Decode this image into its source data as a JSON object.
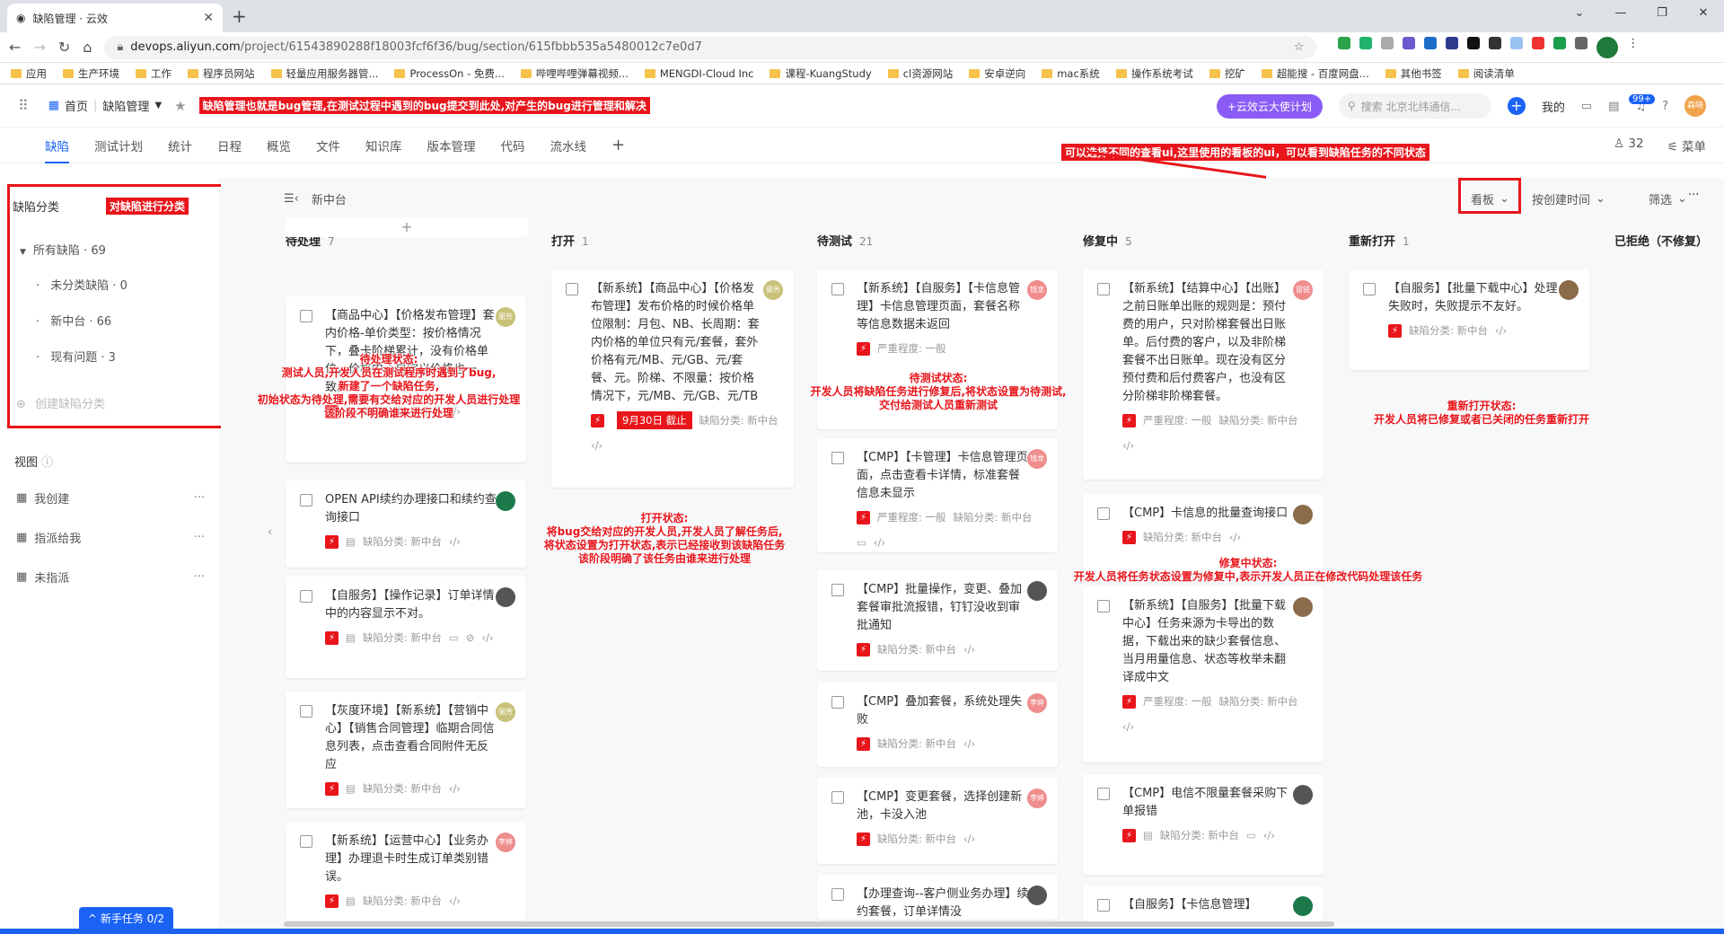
{
  "browser": {
    "tab_title": "缺陷管理 · 云效",
    "url_host": "devops.aliyun.com",
    "url_path": "/project/61543890288f18003fcf6f36/bug/section/615fbbb535a5480012c7e0d7",
    "bookmarks": [
      "应用",
      "生产环境",
      "工作",
      "程序员网站",
      "轻量应用服务器管...",
      "ProcessOn - 免费...",
      "哔哩哔哩弹幕视频...",
      "MENGDI-Cloud Inc",
      "课程-KuangStudy",
      "cl资源网站",
      "安卓逆向",
      "mac系统",
      "操作系统考试",
      "挖矿",
      "超能搜 - 百度网盘...",
      "其他书签",
      "阅读清单"
    ]
  },
  "header": {
    "home": "首页",
    "module": "缺陷管理",
    "annotation": "缺陷管理也就是bug管理,在测试过程中遇到的bug提交到此处,对产生的bug进行管理和解决",
    "promo": "+云效云大使计划",
    "search_placeholder": "搜索 北京北纬通信...",
    "mine": "我的",
    "badge": "99+",
    "user": "森晓"
  },
  "subnav": {
    "tabs": [
      "缺陷",
      "测试计划",
      "统计",
      "日程",
      "概览",
      "文件",
      "知识库",
      "版本管理",
      "代码",
      "流水线"
    ],
    "members": "32",
    "menu": "菜单",
    "annotation": "可以选择不同的查看ui,这里使用的看板的ui，可以看到缺陷任务的不同状态"
  },
  "sidebar": {
    "title": "缺陷分类",
    "annotation": "对缺陷进行分类",
    "all": "所有缺陷 · 69",
    "items": [
      "未分类缺陷 · 0",
      "新中台 · 66",
      "现有问题 · 3"
    ],
    "create": "创建缺陷分类",
    "views_title": "视图",
    "views": [
      "我创建",
      "指派给我",
      "未指派"
    ]
  },
  "board": {
    "crumb": "新中台",
    "view": "看板",
    "sort": "按创建时间",
    "filter": "筛选",
    "columns": [
      {
        "name": "待处理",
        "count": "7"
      },
      {
        "name": "打开",
        "count": "1"
      },
      {
        "name": "待测试",
        "count": "21"
      },
      {
        "name": "修复中",
        "count": "5"
      },
      {
        "name": "重新打开",
        "count": "1"
      },
      {
        "name": "已拒绝（不修复）",
        "count": ""
      }
    ],
    "meta_cat": "缺陷分类: 新中台",
    "severity": "严重程度: 一般",
    "due": "9月30日 截止",
    "cards": {
      "c1": "【商品中心】【价格发布管理】套内价格-单价类型：按价格情况下，叠卡阶梯累计，没有价格单位，价格中心自定义价格也一致。",
      "c2": "OPEN API续约办理接口和续约查询接口",
      "c3": "【自服务】【操作记录】订单详情中的内容显示不对。",
      "c4": "【灰度环境】【新系统】【营销中心】【销售合同管理】临期合同信息列表，点击查看合同附件无反应",
      "c5": "【新系统】【运营中心】【业务办理】办理退卡时生成订单类别错误。",
      "o1": "【新系统】【商品中心】【价格发布管理】发布价格的时候价格单位限制：月包、NB、长周期：套内价格的单位只有元/套餐，套外价格有元/MB、元/GB、元/套餐、元。阶梯、不限量：按价格情况下，元/MB、元/GB、元/TB",
      "t1": "【新系统】【自服务】【卡信息管理】卡信息管理页面，套餐名称等信息数据未返回",
      "t2": "【CMP】【卡管理】卡信息管理页面，点击查看卡详情，标准套餐信息未显示",
      "t3": "【CMP】批量操作，变更、叠加套餐审批流报错，钉钉没收到审批通知",
      "t4": "【CMP】叠加套餐，系统处理失败",
      "t5": "【CMP】变更套餐，选择创建新池，卡没入池",
      "t6": "【办理查询--客户侧业务办理】续约套餐，订单详情没",
      "f1": "【新系统】【结算中心】【出账】之前日账单出账的规则是：预付费的用户，只对阶梯套餐出日账单。后付费的客户，以及非阶梯套餐不出日账单。现在没有区分预付费和后付费客户，也没有区分阶梯非阶梯套餐。",
      "f2": "【CMP】卡信息的批量查询接口",
      "f3": "【新系统】【自服务】【批量下载中心】任务来源为卡导出的数据，下载出来的缺少套餐信息、当月用量信息、状态等枚举未翻译成中文",
      "f4": "【CMP】电信不限量套餐采购下单报错",
      "f5": "【自服务】【卡信息管理】",
      "r1": "【自服务】【批量下载中心】处理失败时，失败提示不友好。"
    },
    "avatars": {
      "a1": "丽芳",
      "a2": "钱龙",
      "a3": "李婷",
      "a4": "苗锐",
      "a5": "俊华",
      "a6": "李婷"
    }
  },
  "annotations": {
    "pending": [
      "待处理状态:",
      "测试人员,开发人员在测试程序时遇到了bug,",
      "新建了一个缺陷任务,",
      "初始状态为待处理,需要有交给对应的开发人员进行处理",
      "该阶段不明确谁来进行处理"
    ],
    "open": [
      "打开状态:",
      "将bug交给对应的开发人员,开发人员了解任务后,",
      "将状态设置为打开状态,表示已经接收到该缺陷任务",
      "该阶段明确了该任务由谁来进行处理"
    ],
    "test": [
      "待测试状态:",
      "开发人员将缺陷任务进行修复后,将状态设置为待测试,",
      "交付给测试人员重新测试"
    ],
    "fixing": [
      "修复中状态:",
      "开发人员将任务状态设置为修复中,表示开发人员正在修改代码处理该任务"
    ],
    "reopen": [
      "重新打开状态:",
      "开发人员将已修复或者已关闭的任务重新打开"
    ]
  },
  "footer": {
    "novice": "^ 新手任务 0/2"
  }
}
